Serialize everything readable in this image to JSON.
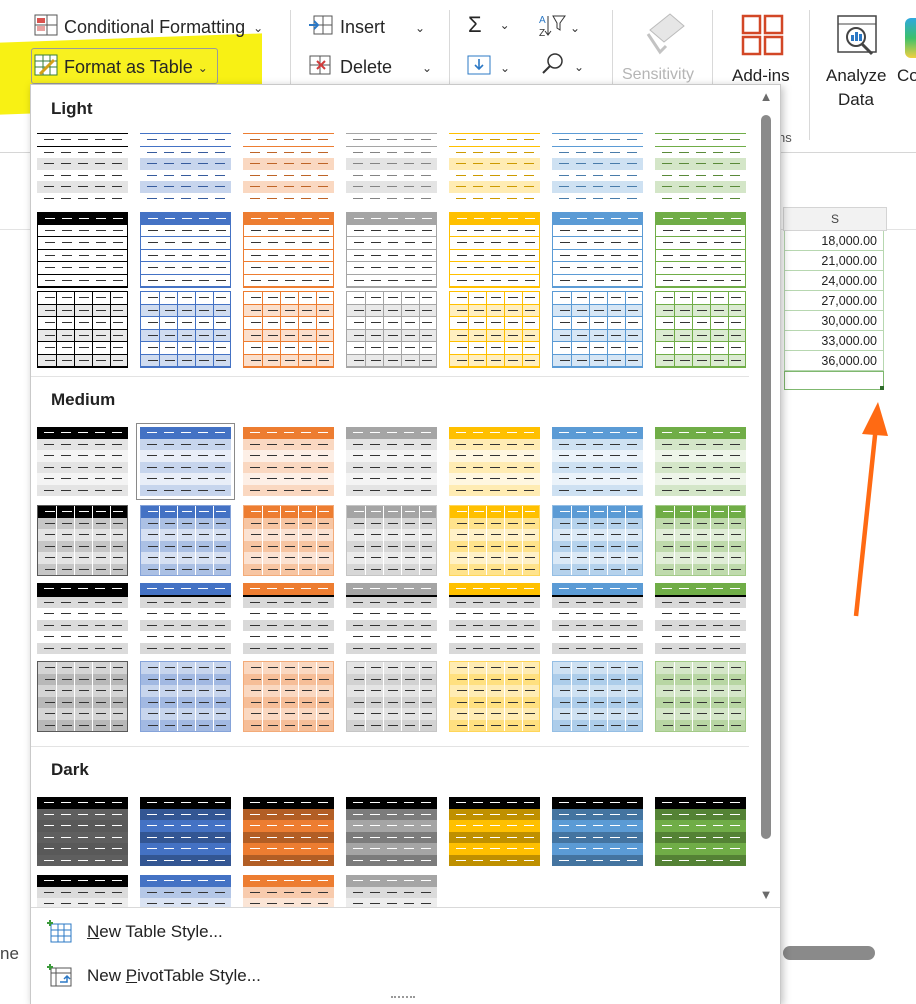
{
  "ribbon": {
    "conditional_formatting": "Conditional Formatting",
    "format_as_table": "Format as Table",
    "insert": "Insert",
    "delete": "Delete",
    "sensitivity": "Sensitivity",
    "addins": "Add-ins",
    "analyze_data_line1": "Analyze",
    "analyze_data_line2": "Data",
    "partial_next": "Co",
    "group_label_fragment": "ns",
    "highlight_color": "#f7f000"
  },
  "sheet": {
    "column_header": "S",
    "values": [
      "18,000.00",
      "21,000.00",
      "24,000.00",
      "27,000.00",
      "30,000.00",
      "33,000.00",
      "36,000.00"
    ],
    "left_fragment": "ne",
    "arrow_color": "#ff6a13"
  },
  "gallery": {
    "sections": {
      "light": "Light",
      "medium": "Medium",
      "dark": "Dark"
    },
    "theme_colors": [
      "#000000",
      "#4472c4",
      "#ed7d31",
      "#a5a5a5",
      "#ffc000",
      "#5b9bd5",
      "#70ad47"
    ]
  },
  "footer": {
    "new_table_style_prefix": "",
    "new_table_style_underline": "N",
    "new_table_style_rest": "ew Table Style...",
    "new_pivot_style_prefix": "New ",
    "new_pivot_style_underline": "P",
    "new_pivot_style_rest": "ivotTable Style..."
  }
}
